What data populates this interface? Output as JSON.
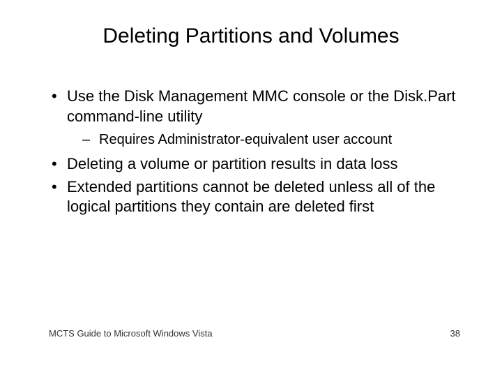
{
  "slide": {
    "title": "Deleting Partitions and Volumes",
    "bullets": [
      {
        "text": "Use the Disk Management MMC console or the Disk.Part command-line utility",
        "sub": [
          "Requires Administrator-equivalent user account"
        ]
      },
      {
        "text": "Deleting a volume or partition results in data loss"
      },
      {
        "text": "Extended partitions cannot be deleted unless all of the logical partitions they contain are deleted first"
      }
    ],
    "footer": {
      "text": "MCTS Guide to Microsoft Windows Vista",
      "page": "38"
    }
  }
}
